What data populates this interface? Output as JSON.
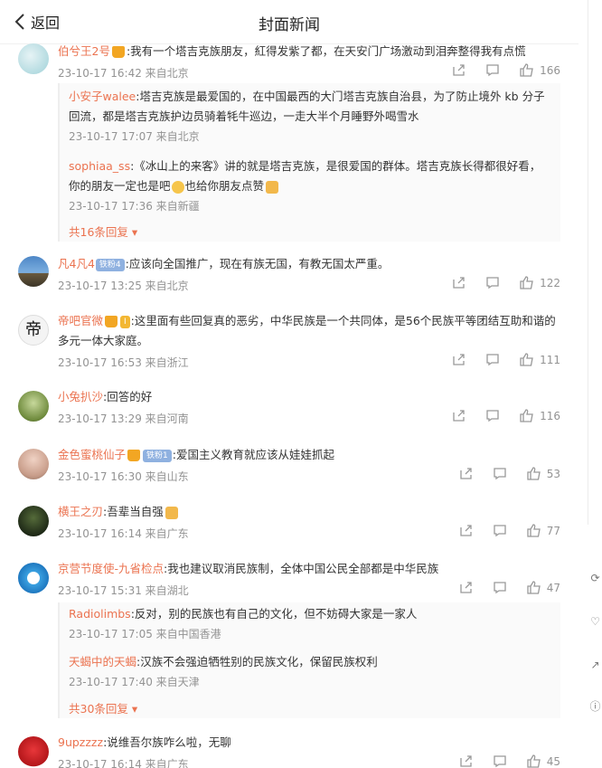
{
  "header": {
    "back_label": "返回",
    "title": "封面新闻"
  },
  "comments": [
    {
      "user": "伯兮王2号",
      "text": ":我有一个塔吉克族朋友，紅得发紫了都，在天安门广场激动到泪奔整得我有点慌",
      "meta": "23-10-17 16:42 来自北京",
      "likes": "166",
      "replies": [
        {
          "user": "小安子walee",
          "text": ":塔吉克族是最爱国的，在中国最西的大门塔吉克族自治县，为了防止境外 kb 分子回流，都是塔吉克族护边员骑着牦牛巡边，一走大半个月睡野外喝雪水",
          "meta": "23-10-17 17:07 来自北京"
        },
        {
          "user": "sophiaa_ss",
          "text": ":《冰山上的来客》讲的就是塔吉克族，是很爱国的群体。塔吉克族长得都很好看，你的朋友一定也是吧",
          "text2": "也给你朋友点赞",
          "meta": "23-10-17 17:36 来自新疆"
        }
      ],
      "more": "共16条回复"
    },
    {
      "user": "凡4凡4",
      "badge": "铁粉4",
      "text": ":应该向全国推广，现在有族无国，有教无国太严重。",
      "meta": "23-10-17 13:25 来自北京",
      "likes": "122"
    },
    {
      "user": "帝吧官微",
      "text": ":这里面有些回复真的恶劣，中华民族是一个共同体，是56个民族平等团结互助和谐的多元一体大家庭。",
      "meta": "23-10-17 16:53 来自浙江",
      "likes": "111"
    },
    {
      "user": "小兔扒沙",
      "text": ":回答的好",
      "meta": "23-10-17 13:29 来自河南",
      "likes": "116"
    },
    {
      "user": "金色蜜桃仙子",
      "badge": "铁粉1",
      "text": ":爱国主义教育就应该从娃娃抓起",
      "meta": "23-10-17 16:30 来自山东",
      "likes": "53"
    },
    {
      "user": "横王之刃",
      "text": ":吾辈当自强",
      "meta": "23-10-17 16:14 来自广东",
      "likes": "77"
    },
    {
      "user": "京营节度使-九省检点",
      "text": ":我也建议取消民族制，全体中国公民全部都是中华民族",
      "meta": "23-10-17 15:31 来自湖北",
      "likes": "47",
      "replies": [
        {
          "user": "Radiolimbs",
          "text": ":反对，别的民族也有自己的文化，但不妨碍大家是一家人",
          "meta": "23-10-17 17:05 来自中国香港"
        },
        {
          "user": "天蝎中的天蝎",
          "text": ":汉族不会强迫牺牲别的民族文化，保留民族权利",
          "meta": "23-10-17 17:40 来自天津"
        }
      ],
      "more": "共30条回复"
    },
    {
      "user": "9upzzzz",
      "text": ":说维吾尔族咋么啦，无聊",
      "meta": "23-10-17 16:14 来自广东",
      "likes": "45"
    }
  ]
}
